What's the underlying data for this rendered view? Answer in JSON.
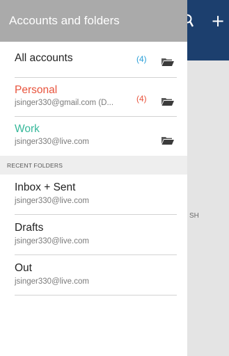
{
  "background": {
    "header_color": "#1c3f6e",
    "partial_text": "SH",
    "icons": [
      "search-icon",
      "add-icon"
    ]
  },
  "drawer": {
    "title": "Accounts and folders",
    "accounts": [
      {
        "name": "All accounts",
        "email": "",
        "count": "(4)",
        "name_color": "#222222",
        "count_color": "#2a9fd8"
      },
      {
        "name": "Personal",
        "email": "jsinger330@gmail.com (D...",
        "count": "(4)",
        "name_color": "#e8533c",
        "count_color": "#e8533c"
      },
      {
        "name": "Work",
        "email": "jsinger330@live.com",
        "count": "",
        "name_color": "#36b89a",
        "count_color": "#222222"
      }
    ],
    "recent_folders_label": "RECENT FOLDERS",
    "recent_folders": [
      {
        "name": "Inbox + Sent",
        "email": "jsinger330@live.com"
      },
      {
        "name": "Drafts",
        "email": "jsinger330@live.com"
      },
      {
        "name": "Out",
        "email": "jsinger330@live.com"
      }
    ]
  }
}
